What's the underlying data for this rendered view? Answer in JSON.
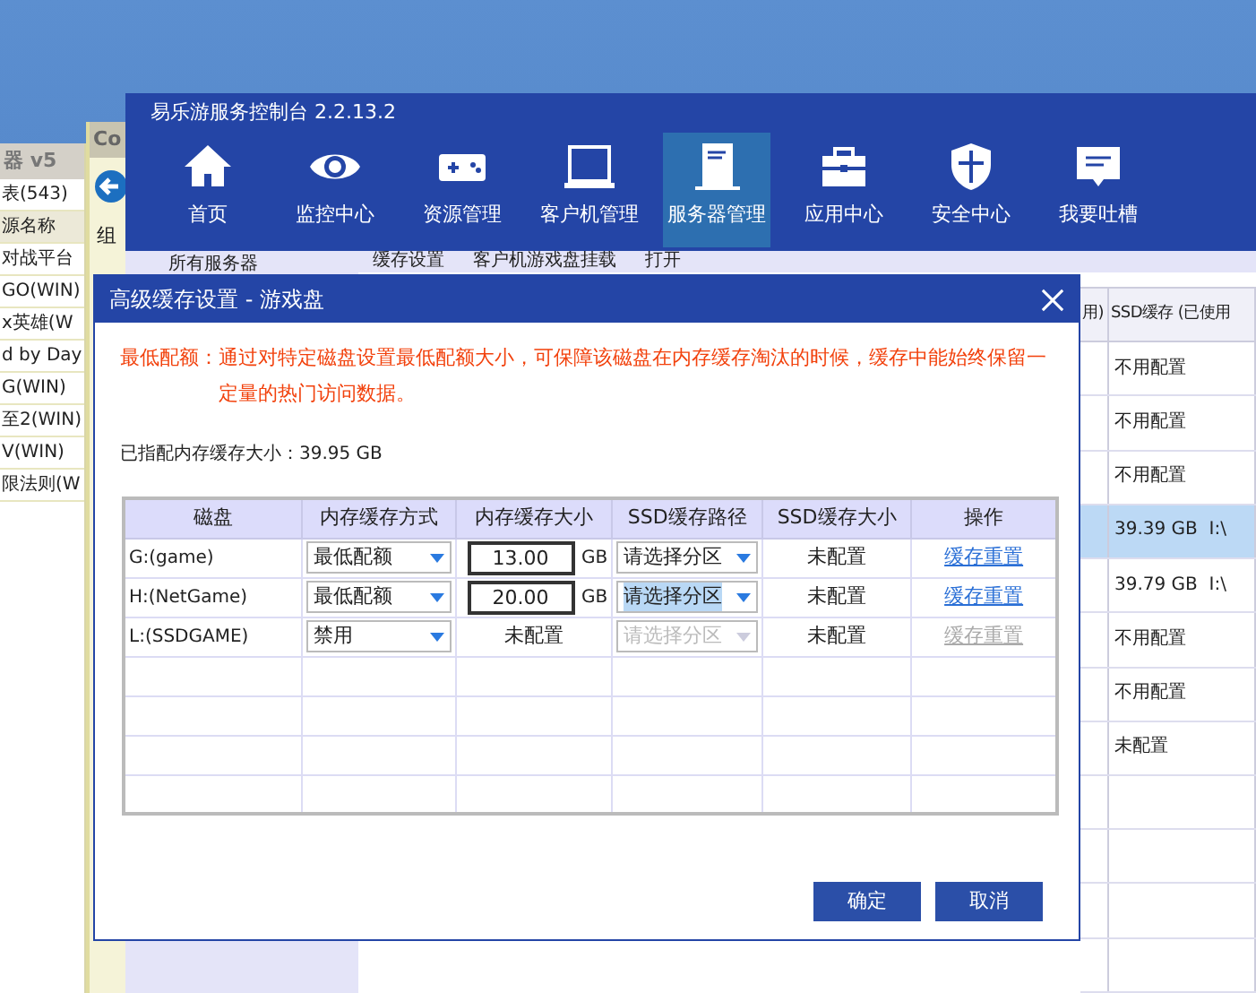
{
  "back_window_list": {
    "title": "器 v5",
    "count_label": "表(543)",
    "column": "源名称",
    "rows": [
      "对战平台",
      "GO(WIN)",
      "x英雄(W",
      "d by Day",
      "G(WIN)",
      "至2(WIN)",
      "V(WIN)",
      "限法则(W"
    ]
  },
  "back_window_explorer": {
    "title": "Co",
    "address": "组"
  },
  "app": {
    "title": "易乐游服务控制台 2.2.13.2",
    "nav": [
      {
        "label": "首页",
        "selected": false
      },
      {
        "label": "监控中心",
        "selected": false
      },
      {
        "label": "资源管理",
        "selected": false
      },
      {
        "label": "客户机管理",
        "selected": false
      },
      {
        "label": "服务器管理",
        "selected": true
      },
      {
        "label": "应用中心",
        "selected": false
      },
      {
        "label": "安全中心",
        "selected": false
      },
      {
        "label": "我要吐槽",
        "selected": false
      }
    ],
    "sidebar": {
      "items": [
        "所有服务器"
      ]
    },
    "toolbar": [
      "缓存设置",
      "客户机游戏盘挂载",
      "打开"
    ],
    "table": {
      "columns": [
        "用)",
        "SSD缓存 (已使用"
      ],
      "rows": [
        {
          "cells": [
            "",
            "不用配置"
          ],
          "selected": false
        },
        {
          "cells": [
            "",
            "不用配置"
          ],
          "selected": false
        },
        {
          "cells": [
            "",
            "不用配置"
          ],
          "selected": false
        },
        {
          "cells": [
            "",
            "39.39 GB  I:\\"
          ],
          "selected": true
        },
        {
          "cells": [
            "",
            "39.79 GB  I:\\"
          ],
          "selected": false
        },
        {
          "cells": [
            "",
            "不用配置"
          ],
          "selected": false
        },
        {
          "cells": [
            "",
            "不用配置"
          ],
          "selected": false
        },
        {
          "cells": [
            "",
            "未配置"
          ],
          "selected": false
        }
      ]
    }
  },
  "dialog": {
    "title": "高级缓存设置 - 游戏盘",
    "note_label": "最低配额：",
    "note_text": "通过对特定磁盘设置最低配额大小，可保障该磁盘在内存缓存淘汰的时候，缓存中能始终保留一定量的热门访问数据。",
    "assigned": "已指配内存缓存大小：39.95 GB",
    "columns": [
      "磁盘",
      "内存缓存方式",
      "内存缓存大小",
      "SSD缓存路径",
      "SSD缓存大小",
      "操作"
    ],
    "rows": [
      {
        "disk": "G:(game)",
        "mode": "最低配额",
        "size": {
          "kind": "input",
          "value": "13.00",
          "unit": "GB"
        },
        "ssd_path": {
          "value": "请选择分区",
          "disabled": false,
          "highlighted": false
        },
        "ssd_size": "未配置",
        "action": {
          "label": "缓存重置",
          "disabled": false
        }
      },
      {
        "disk": "H:(NetGame)",
        "mode": "最低配额",
        "size": {
          "kind": "input",
          "value": "20.00",
          "unit": "GB"
        },
        "ssd_path": {
          "value": "请选择分区",
          "disabled": false,
          "highlighted": true
        },
        "ssd_size": "未配置",
        "action": {
          "label": "缓存重置",
          "disabled": false
        }
      },
      {
        "disk": "L:(SSDGAME)",
        "mode": "禁用",
        "size": {
          "kind": "text",
          "value": "未配置"
        },
        "ssd_path": {
          "value": "请选择分区",
          "disabled": true,
          "highlighted": false
        },
        "ssd_size": "未配置",
        "action": {
          "label": "缓存重置",
          "disabled": true
        }
      }
    ],
    "buttons": [
      "确定",
      "取消"
    ]
  }
}
